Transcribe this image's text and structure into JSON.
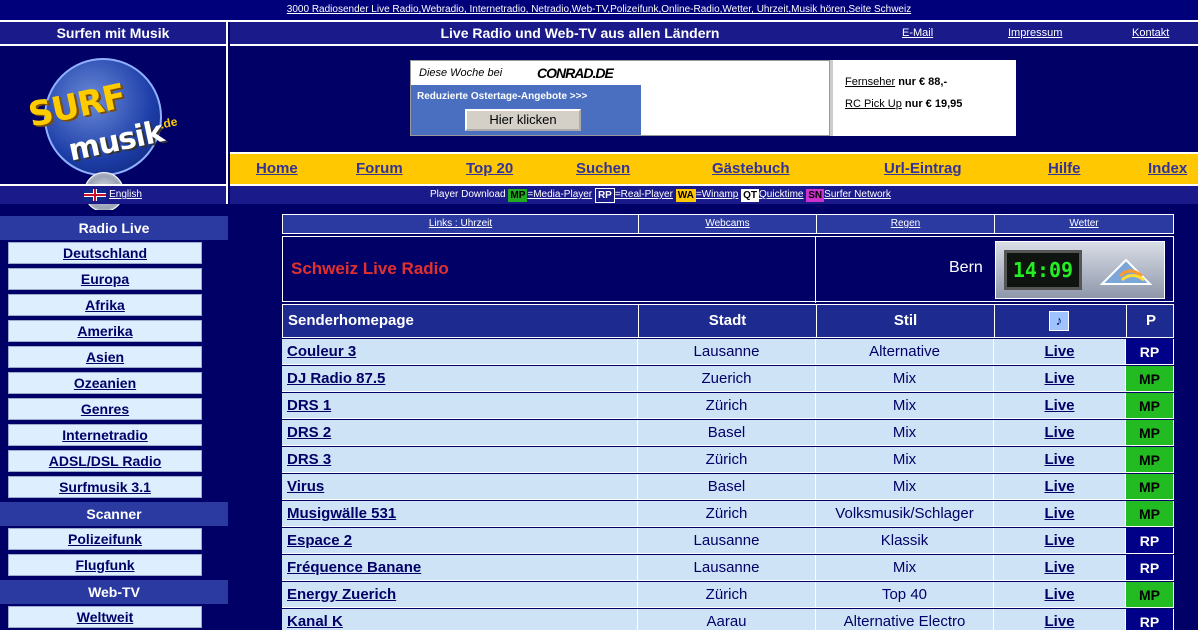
{
  "top_strip": "3000 Radiosender Live Radio,Webradio, Internetradio, Netradio,Web-TV,Polizeifunk,Online-Radio,Wetter, Uhrzeit,Musik hören,Seite Schweiz",
  "header": {
    "left_title": "Surfen mit Musik",
    "center_title": "Live Radio und Web-TV aus allen Ländern",
    "email": "E-Mail",
    "impressum": "Impressum",
    "kontakt": "Kontakt"
  },
  "logo": {
    "line1": "SURF",
    "line2": "musik",
    "suffix": ".de"
  },
  "ads": {
    "conrad_prefix": "Diese Woche bei",
    "conrad_brand": "CONRAD.DE",
    "conrad_text": "Reduzierte Ostertage-Angebote >>>",
    "button": "Hier klicken",
    "line1_link": "Fernseher",
    "line1_rest": "nur € 88,-",
    "line2_link": "RC Pick Up",
    "line2_rest": "nur € 19,95"
  },
  "nav": [
    "Home",
    "Forum",
    "Top 20",
    "Suchen",
    "Gästebuch",
    "Url-Eintrag",
    "Hilfe",
    "Index"
  ],
  "english": "English",
  "player_bar": {
    "prefix": "Player Download",
    "items": [
      {
        "tag": "MP",
        "label": "=Media-Player",
        "style": "mp"
      },
      {
        "tag": "RP",
        "label": "=Real-Player",
        "style": "rp"
      },
      {
        "tag": "WA",
        "label": "=Winamp",
        "style": "wa"
      },
      {
        "tag": "QT",
        "label": "Quicktime",
        "style": "qt"
      },
      {
        "tag": "SN",
        "label": "Surfer Network",
        "style": "sn"
      }
    ]
  },
  "sidebar": {
    "sections": [
      {
        "title": "Radio Live",
        "items": [
          "Deutschland",
          "Europa",
          "Afrika",
          "Amerika",
          "Asien",
          "Ozeanien",
          "Genres",
          "Internetradio",
          "ADSL/DSL Radio",
          "Surfmusik 3.1"
        ]
      },
      {
        "title": "Scanner",
        "items": [
          "Polizeifunk",
          "Flugfunk"
        ]
      },
      {
        "title": "Web-TV",
        "items": [
          "Weltweit"
        ]
      }
    ]
  },
  "tabs": [
    "Links : Uhrzeit",
    "Webcams",
    "Regen",
    "Wetter"
  ],
  "title_row": {
    "country_title": "Schweiz Live Radio",
    "city": "Bern",
    "clock": "14:09"
  },
  "table": {
    "headers": [
      "Senderhomepage",
      "Stadt",
      "Stil",
      "",
      "P"
    ],
    "speaker_icon": "speaker-icon",
    "rows": [
      {
        "name": "Couleur 3",
        "city": "Lausanne",
        "stil": "Alternative",
        "live": "Live",
        "p": "RP"
      },
      {
        "name": "DJ Radio 87.5",
        "city": "Zuerich",
        "stil": "Mix",
        "live": "Live",
        "p": "MP"
      },
      {
        "name": "DRS 1",
        "city": "Zürich",
        "stil": "Mix",
        "live": "Live",
        "p": "MP"
      },
      {
        "name": "DRS 2",
        "city": "Basel",
        "stil": "Mix",
        "live": "Live",
        "p": "MP"
      },
      {
        "name": "DRS 3",
        "city": "Zürich",
        "stil": "Mix",
        "live": "Live",
        "p": "MP"
      },
      {
        "name": "Virus",
        "city": "Basel",
        "stil": "Mix",
        "live": "Live",
        "p": "MP"
      },
      {
        "name": "Musigwälle 531",
        "city": "Zürich",
        "stil": "Volksmusik/Schlager",
        "live": "Live",
        "p": "MP"
      },
      {
        "name": "Espace 2",
        "city": "Lausanne",
        "stil": "Klassik",
        "live": "Live",
        "p": "RP"
      },
      {
        "name": "Fréquence Banane",
        "city": "Lausanne",
        "stil": "Mix",
        "live": "Live",
        "p": "RP"
      },
      {
        "name": "Energy Zuerich",
        "city": "Zürich",
        "stil": "Top 40",
        "live": "Live",
        "p": "MP"
      },
      {
        "name": "Kanal K",
        "city": "Aarau",
        "stil": "Alternative Electro",
        "live": "Live",
        "p": "RP"
      }
    ]
  },
  "colors": {
    "background": "#000066",
    "nav_bar": "#ffc800",
    "row_bg": "#cfe3f7",
    "title_red": "#e23030",
    "mp_green": "#22bb22",
    "rp_blue": "#000088"
  }
}
